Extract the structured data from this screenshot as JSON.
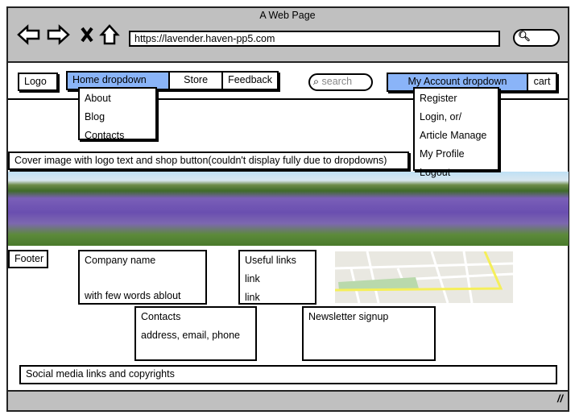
{
  "browser": {
    "title": "A Web Page",
    "url": "https://lavender.haven-pp5.com"
  },
  "nav": {
    "logo": "Logo",
    "home": "Home dropdown",
    "store": "Store",
    "feedback": "Feedback",
    "search_placeholder": "search",
    "account": "My Account dropdown",
    "cart": "cart"
  },
  "home_menu": [
    "About",
    "Blog",
    "Contacts"
  ],
  "account_menu": [
    "Register",
    "Login, or/",
    "Article Manage",
    "My Profile",
    "Logout"
  ],
  "cover_label": "Cover image with logo text and shop button(couldn't display fully due to dropdowns)",
  "footer": {
    "label": "Footer",
    "company_title": "Company name",
    "company_text": "with few words ablout",
    "links_title": "Useful links",
    "links": [
      "link",
      "link"
    ],
    "contacts_title": "Contacts",
    "contacts_text": "address, email, phone",
    "newsletter": "Newsletter signup",
    "social": "Social media links and copyrights"
  }
}
